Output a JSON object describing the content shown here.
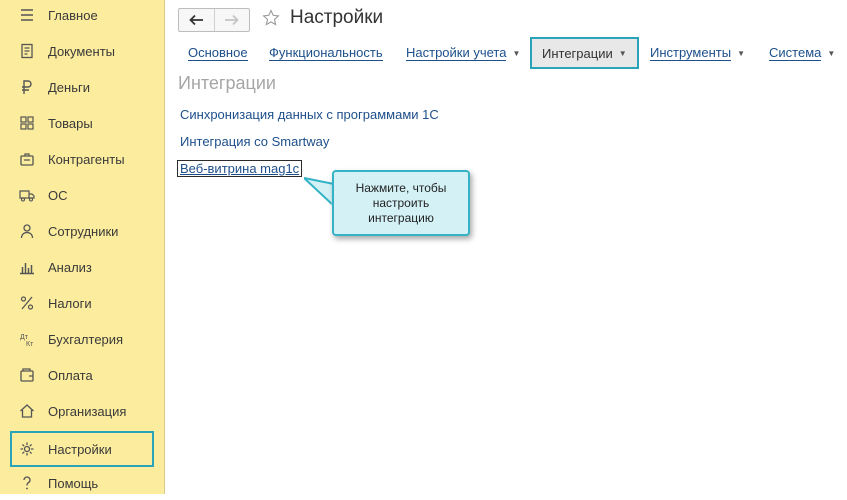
{
  "sidebar": {
    "items": [
      {
        "label": "Главное",
        "icon": "menu-icon"
      },
      {
        "label": "Документы",
        "icon": "document-icon"
      },
      {
        "label": "Деньги",
        "icon": "ruble-icon"
      },
      {
        "label": "Товары",
        "icon": "goods-grid-icon"
      },
      {
        "label": "Контрагенты",
        "icon": "handshake-icon"
      },
      {
        "label": "ОС",
        "icon": "truck-icon"
      },
      {
        "label": "Сотрудники",
        "icon": "person-icon"
      },
      {
        "label": "Анализ",
        "icon": "bar-chart-icon"
      },
      {
        "label": "Налоги",
        "icon": "percent-icon"
      },
      {
        "label": "Бухгалтерия",
        "icon": "dt-kt-icon"
      },
      {
        "label": "Оплата",
        "icon": "wallet-icon"
      },
      {
        "label": "Организация",
        "icon": "house-icon"
      },
      {
        "label": "Настройки",
        "icon": "gear-icon"
      },
      {
        "label": "Помощь",
        "icon": "question-icon"
      }
    ],
    "active": "Настройки"
  },
  "header": {
    "title": "Настройки"
  },
  "tabs": [
    {
      "label": "Основное",
      "dropdown": false
    },
    {
      "label": "Функциональность",
      "dropdown": false
    },
    {
      "label": "Настройки учета",
      "dropdown": true
    },
    {
      "label": "Интеграции",
      "dropdown": true
    },
    {
      "label": "Инструменты",
      "dropdown": true
    },
    {
      "label": "Система",
      "dropdown": true
    }
  ],
  "active_tab": "Интеграции",
  "section": {
    "title": "Интеграции",
    "links": [
      "Синхронизация данных с программами 1С",
      "Интеграция со Smartway",
      "Веб-витрина mag1c"
    ]
  },
  "tooltip": {
    "text": "Нажмите, чтобы настроить интеграцию"
  },
  "colors": {
    "sidebar_bg": "#fbec9e",
    "highlight": "#2aa4b8",
    "link": "#1d4f8b",
    "tooltip_bg": "#d4f2f6"
  }
}
